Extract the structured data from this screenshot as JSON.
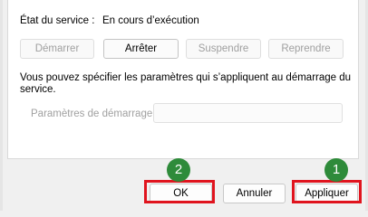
{
  "service": {
    "status_label": "État du service :",
    "status_value": "En cours d’exécution"
  },
  "controls": {
    "start": "Démarrer",
    "stop": "Arrêter",
    "pause": "Suspendre",
    "resume": "Reprendre"
  },
  "info_text_line1": "Vous pouvez spécifier les paramètres qui s’appliquent au démarrage du",
  "info_text_line2": "service.",
  "params": {
    "label": "Paramètres de démarrage :",
    "value": ""
  },
  "dialog_buttons": {
    "ok": "OK",
    "cancel": "Annuler",
    "apply": "Appliquer"
  },
  "annotations": {
    "badge_apply": "1",
    "badge_ok": "2",
    "highlight_color": "#e0141e",
    "badge_color": "#2e8b3a"
  }
}
